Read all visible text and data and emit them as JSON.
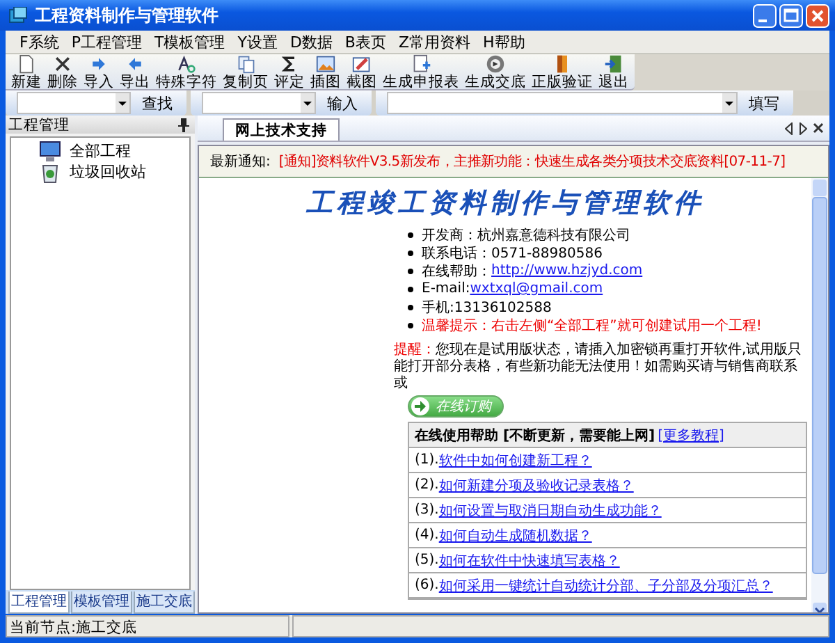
{
  "window": {
    "title": "工程资料制作与管理软件"
  },
  "menu": [
    "F系统",
    "P工程管理",
    "T模板管理",
    "Y设置",
    "D数据",
    "B表页",
    "Z常用资料",
    "H帮助"
  ],
  "toolbar": [
    "新建",
    "删除",
    "导入",
    "导出",
    "特殊字符",
    "复制页",
    "评定",
    "插图",
    "截图",
    "生成申报表",
    "生成交底",
    "正版验证",
    "退出"
  ],
  "find_bar": [
    {
      "button": "查找"
    },
    {
      "button": "输入"
    },
    {
      "button": "填写"
    }
  ],
  "sidebar": {
    "title": "工程管理",
    "tree": [
      {
        "label": "全部工程"
      },
      {
        "label": "垃圾回收站"
      }
    ],
    "tabs": [
      {
        "label": "工程管理",
        "selected": true
      },
      {
        "label": "模板管理",
        "selected": false
      },
      {
        "label": "施工交底",
        "selected": false
      }
    ]
  },
  "document_tabs": [
    {
      "label": "网上技术支持",
      "selected": true
    }
  ],
  "notice": {
    "label": "最新通知:",
    "text": "[通知]资料软件V3.5新发布，主推新功能：快速生成各类分项技术交底资料[07-11-7]"
  },
  "page": {
    "title": "工程竣工资料制作与管理软件",
    "info": [
      {
        "kind": "plain",
        "label": "开发商：杭州嘉意德科技有限公司"
      },
      {
        "kind": "plain",
        "label": "联系电话：0571-88980586"
      },
      {
        "kind": "link",
        "label": "在线帮助：",
        "link": "http://www.hzjyd.com"
      },
      {
        "kind": "link",
        "label": "E-mail:",
        "link": "wxtxql@gmail.com"
      },
      {
        "kind": "plain",
        "label": "手机:13136102588"
      },
      {
        "kind": "warning",
        "label": "温馨提示：右击左侧“全部工程”就可创建试用一个工程!"
      }
    ],
    "reminder": {
      "label": "提醒：",
      "text": "您现在是试用版状态，请插入加密锁再重打开软件,试用版只能打开部分表格，有些新功能无法使用！如需购买请与销售商联系或"
    },
    "order_button": "在线订购",
    "help": {
      "title": "在线使用帮助 [不断更新，需要能上网]",
      "more": "[更多教程]",
      "items": [
        {
          "number": "(1).",
          "link": "软件中如何创建新工程？"
        },
        {
          "number": "(2).",
          "link": "如何新建分项及验收记录表格？"
        },
        {
          "number": "(3).",
          "link": "如何设置与取消日期自动生成功能？"
        },
        {
          "number": "(4).",
          "link": "如何自动生成随机数据？"
        },
        {
          "number": "(5).",
          "link": "如何在软件中快速填写表格？"
        },
        {
          "number": "(6).",
          "link": "如何采用一键统计自动统计分部、子分部及分项汇总？"
        }
      ]
    }
  },
  "status_bar": {
    "text": "当前节点:施工交底"
  }
}
